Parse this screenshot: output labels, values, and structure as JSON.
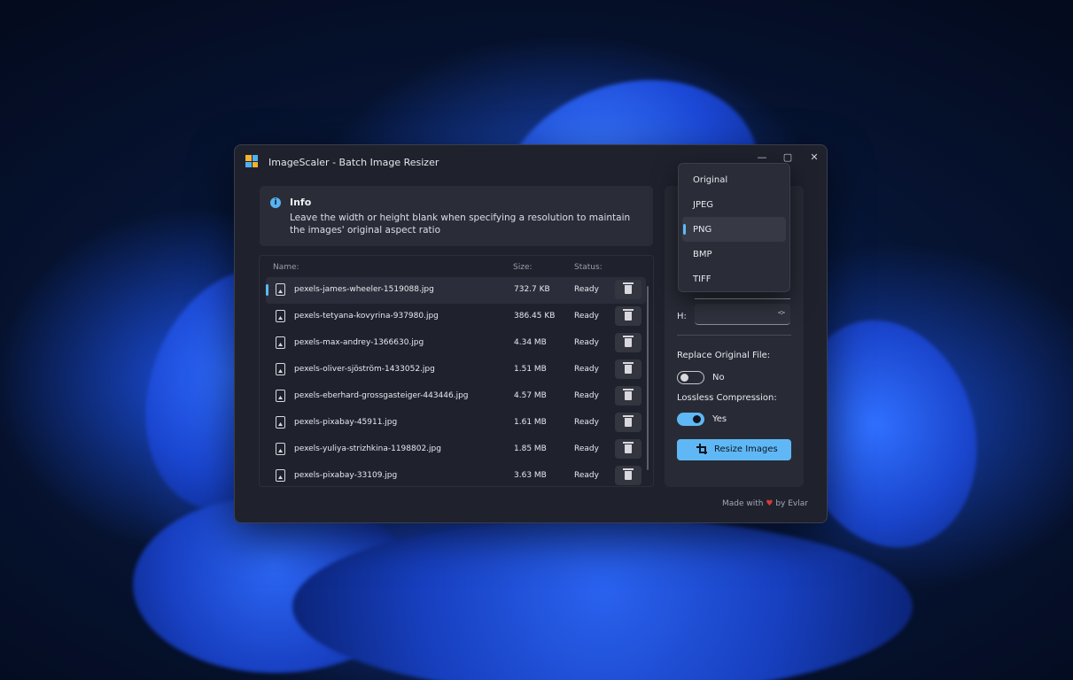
{
  "window": {
    "title": "ImageScaler - Batch Image Resizer",
    "controls": {
      "minimize": "—",
      "maximize": "▢",
      "close": "✕"
    }
  },
  "info": {
    "title": "Info",
    "text": "Leave the width or height blank when specifying a resolution to maintain the images' original aspect ratio"
  },
  "file_list": {
    "headers": {
      "name": "Name:",
      "size": "Size:",
      "status": "Status:"
    },
    "rows": [
      {
        "name": "pexels-james-wheeler-1519088.jpg",
        "size": "732.7 KB",
        "status": "Ready"
      },
      {
        "name": "pexels-tetyana-kovyrina-937980.jpg",
        "size": "386.45 KB",
        "status": "Ready"
      },
      {
        "name": "pexels-max-andrey-1366630.jpg",
        "size": "4.34 MB",
        "status": "Ready"
      },
      {
        "name": "pexels-oliver-sjöström-1433052.jpg",
        "size": "1.51 MB",
        "status": "Ready"
      },
      {
        "name": "pexels-eberhard-grossgasteiger-443446.jpg",
        "size": "4.57 MB",
        "status": "Ready"
      },
      {
        "name": "pexels-pixabay-45911.jpg",
        "size": "1.61 MB",
        "status": "Ready"
      },
      {
        "name": "pexels-yuliya-strizhkina-1198802.jpg",
        "size": "1.85 MB",
        "status": "Ready"
      },
      {
        "name": "pexels-pixabay-33109.jpg",
        "size": "3.63 MB",
        "status": "Ready"
      }
    ]
  },
  "format_dropdown": {
    "options": [
      "Original",
      "JPEG",
      "PNG",
      "BMP",
      "TIFF"
    ],
    "selected": "PNG"
  },
  "settings": {
    "height_label": "H:",
    "replace_label": "Replace Original File:",
    "replace_state": "No",
    "lossless_label": "Lossless Compression:",
    "lossless_state": "Yes",
    "resize_button": "Resize Images"
  },
  "footer": {
    "made_with": "Made with",
    "heart": "♥",
    "by": "by Evlar"
  },
  "colors": {
    "accent": "#5fb8f5",
    "window_bg": "#1f222d",
    "panel_bg": "#282b36",
    "heart": "#d83a3a"
  }
}
